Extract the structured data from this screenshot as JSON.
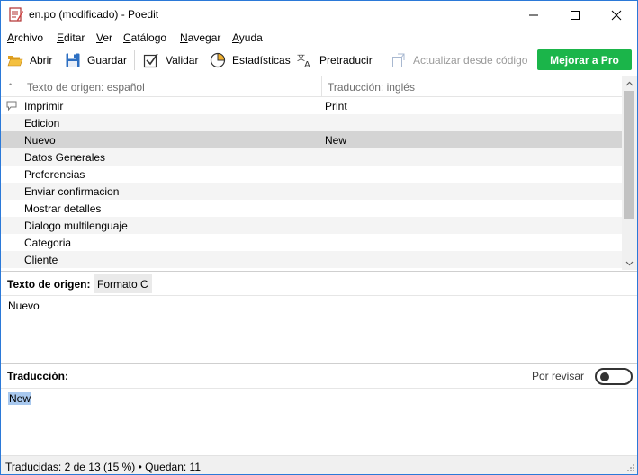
{
  "window": {
    "title": "en.po (modificado) - Poedit"
  },
  "menu": [
    {
      "label": "Archivo",
      "u": "A",
      "rest": "rchivo"
    },
    {
      "label": "Editar",
      "u": "E",
      "rest": "ditar"
    },
    {
      "label": "Ver",
      "u": "V",
      "rest": "er"
    },
    {
      "label": "Catálogo",
      "u": "C",
      "rest": "atálogo"
    },
    {
      "label": "Navegar",
      "u": "N",
      "rest": "avegar"
    },
    {
      "label": "Ayuda",
      "u": "A",
      "rest": "yuda"
    }
  ],
  "toolbar": {
    "open": "Abrir",
    "save": "Guardar",
    "validate": "Validar",
    "stats": "Estadísticas",
    "pretranslate": "Pretraducir",
    "update": "Actualizar desde código",
    "pro": "Mejorar a Pro"
  },
  "list": {
    "header_source": "Texto de origen: español",
    "header_translation": "Traducción: inglés",
    "rows": [
      {
        "source": "Imprimir",
        "translation": "Print",
        "comment": true
      },
      {
        "source": "Edicion",
        "translation": ""
      },
      {
        "source": "Nuevo",
        "translation": "New",
        "selected": true
      },
      {
        "source": "Datos Generales",
        "translation": ""
      },
      {
        "source": "Preferencias",
        "translation": ""
      },
      {
        "source": "Enviar confirmacion",
        "translation": ""
      },
      {
        "source": "Mostrar detalles",
        "translation": ""
      },
      {
        "source": "Dialogo multilenguaje",
        "translation": ""
      },
      {
        "source": "Categoria",
        "translation": ""
      },
      {
        "source": "Cliente",
        "translation": ""
      }
    ]
  },
  "source_pane": {
    "label": "Texto de origen:",
    "format_tag": "Formato C",
    "text": "Nuevo"
  },
  "translation_pane": {
    "label": "Traducción:",
    "needs_review_label": "Por revisar",
    "needs_review": false,
    "text": "New"
  },
  "status": {
    "text": "Traducidas: 2 de 13 (15 %)  •  Quedan: 11"
  },
  "colors": {
    "pro_button": "#1bb54a",
    "selected_row": "#d4d4d4",
    "text_selection": "#a8c8ee",
    "window_border": "#2b79d8"
  }
}
